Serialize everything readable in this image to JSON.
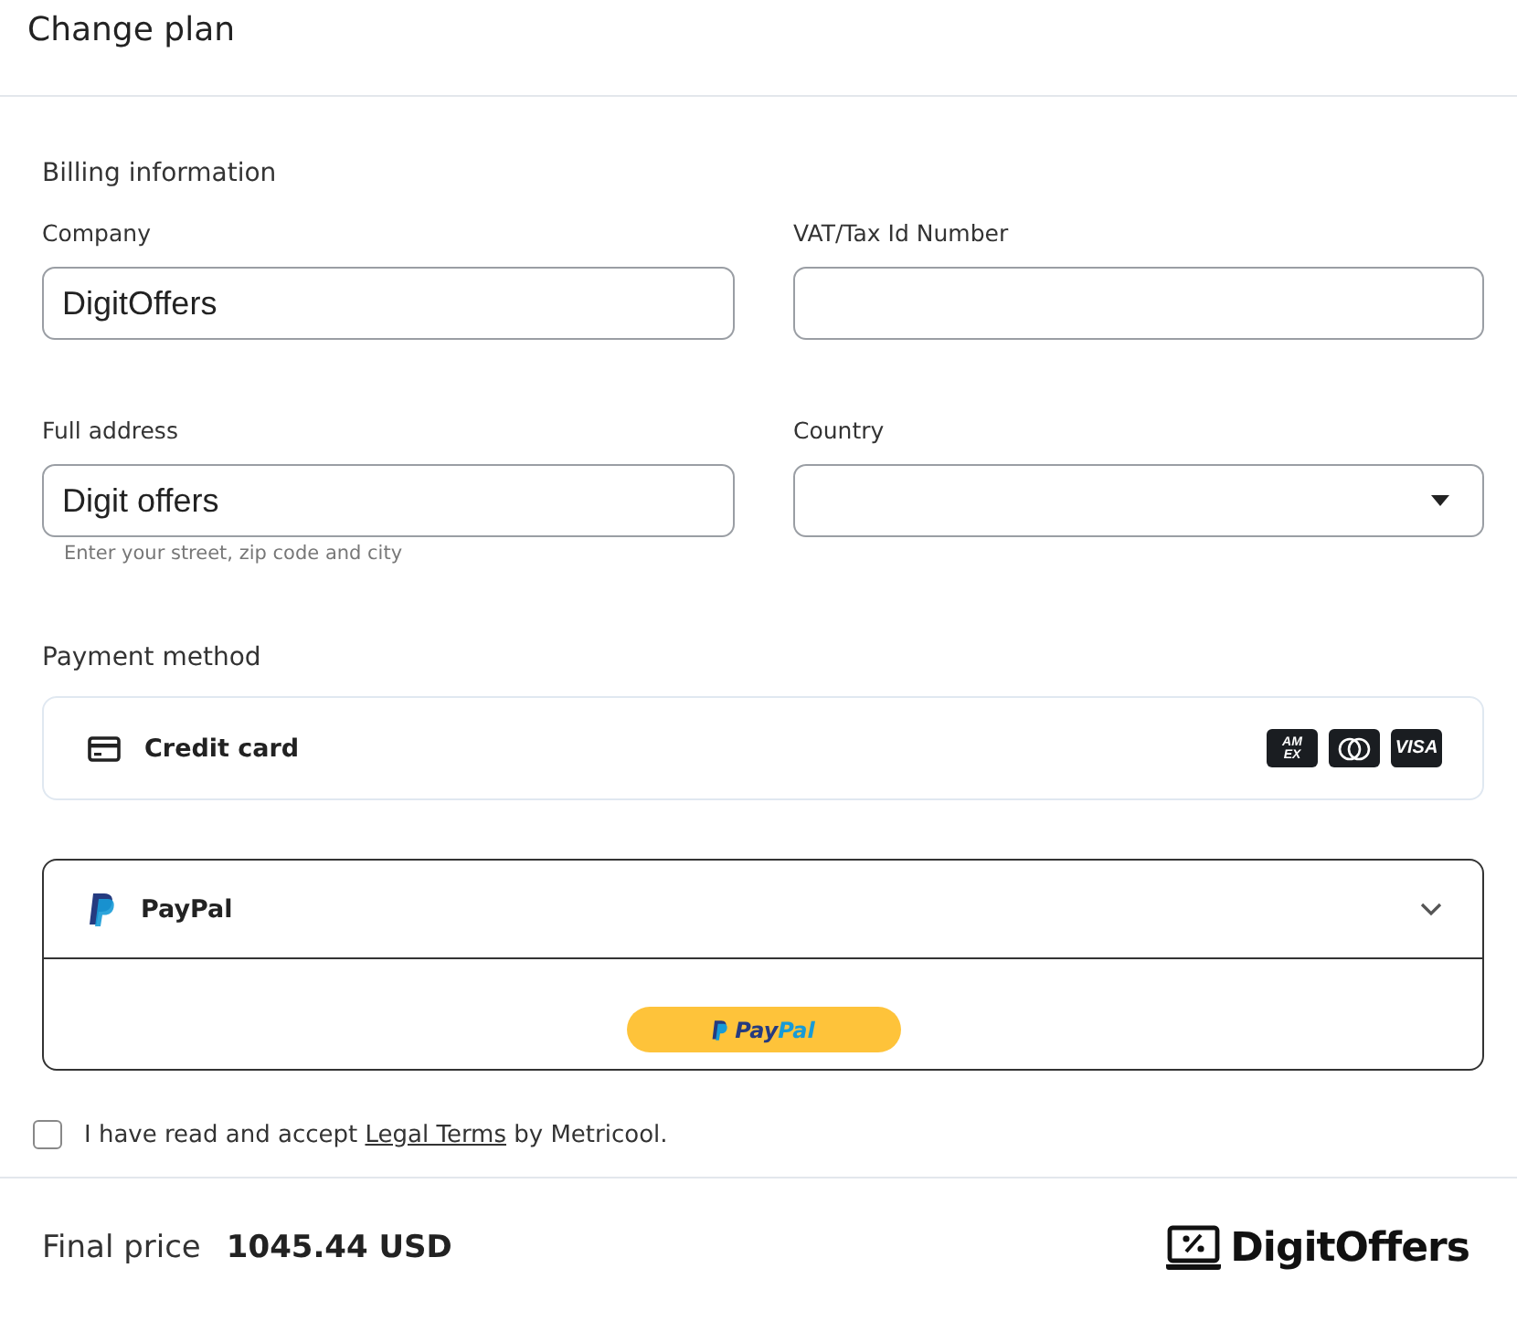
{
  "header": {
    "title": "Change plan"
  },
  "billing": {
    "heading": "Billing information",
    "fields": [
      {
        "label": "Company",
        "value": "DigitOffers",
        "kind": "text"
      },
      {
        "label": "VAT/Tax Id Number",
        "kind": "text"
      },
      {
        "label": "Full address",
        "value": "Digit offers",
        "kind": "text",
        "hint": "Enter your street, zip code and city"
      },
      {
        "label": "Country",
        "kind": "select"
      }
    ]
  },
  "payment": {
    "heading": "Payment method",
    "methods": [
      {
        "kind": "card",
        "label": "Credit card",
        "selected": false,
        "brands": [
          {
            "kind": "amex",
            "text": "AM EX"
          },
          {
            "kind": "mastercard"
          },
          {
            "kind": "visa",
            "text": "VISA"
          }
        ]
      },
      {
        "kind": "paypal",
        "label": "PayPal",
        "selected": true,
        "expanded": true,
        "button": {
          "first": "Pay",
          "second": "Pal"
        }
      }
    ]
  },
  "terms": {
    "checked": false,
    "before": "I have read and accept",
    "link": "Legal Terms",
    "after": "by Metricool."
  },
  "footer": {
    "label": "Final price",
    "price": "1045.44 USD",
    "logo": "DigitOffers"
  }
}
